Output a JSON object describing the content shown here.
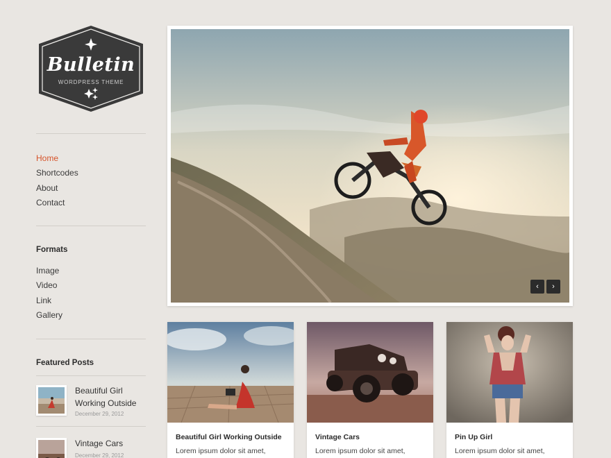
{
  "logo": {
    "title": "Bulletin",
    "subtitle": "WORDPRESS THEME"
  },
  "nav": {
    "items": [
      "Home",
      "Shortcodes",
      "About",
      "Contact"
    ],
    "active": "Home"
  },
  "formats": {
    "title": "Formats",
    "items": [
      "Image",
      "Video",
      "Link",
      "Gallery"
    ]
  },
  "featured": {
    "title": "Featured Posts",
    "posts": [
      {
        "title": "Beautiful Girl Working Outside",
        "date": "December 29, 2012"
      },
      {
        "title": "Vintage Cars",
        "date": "December 29, 2012"
      }
    ]
  },
  "slider": {
    "prev_icon": "chevron-left-icon",
    "next_icon": "chevron-right-icon",
    "prev_glyph": "‹",
    "next_glyph": "›"
  },
  "cards": [
    {
      "title": "Beautiful Girl Working Outside",
      "excerpt": "Lorem ipsum dolor sit amet,"
    },
    {
      "title": "Vintage Cars",
      "excerpt": "Lorem ipsum dolor sit amet,"
    },
    {
      "title": "Pin Up Girl",
      "excerpt": "Lorem ipsum dolor sit amet,"
    }
  ],
  "colors": {
    "accent": "#d6542b",
    "background": "#e9e6e2",
    "logo_dark": "#3a3a3a"
  }
}
